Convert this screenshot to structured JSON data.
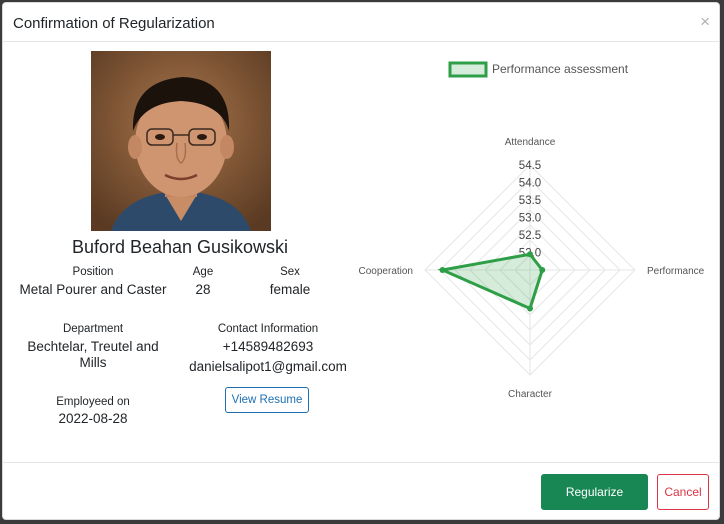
{
  "dialog": {
    "title": "Confirmation of Regularization",
    "close_label": "×"
  },
  "employee": {
    "name": "Buford Beahan Gusikowski",
    "position_label": "Position",
    "position": "Metal Pourer and Caster",
    "age_label": "Age",
    "age": "28",
    "sex_label": "Sex",
    "sex": "female",
    "department_label": "Department",
    "department": "Bechtelar, Treutel and Mills",
    "contact_label": "Contact Information",
    "phone": "+14589482693",
    "email": "danielsalipot1@gmail.com",
    "employed_label": "Employeed on",
    "employed_on": "2022-08-28",
    "resume_button": "View Resume"
  },
  "footer": {
    "regularize_button": "Regularize",
    "cancel_button": "Cancel"
  },
  "colors": {
    "primary": "#198754",
    "danger": "#dc3545",
    "link": "#1f6fb0"
  },
  "chart_data": {
    "type": "radar",
    "legend": [
      "Performance assessment"
    ],
    "axes": [
      "Attendance",
      "Performance",
      "Character",
      "Cooperation"
    ],
    "ticks": [
      "52.0",
      "52.5",
      "53.0",
      "53.5",
      "54.0",
      "54.5"
    ],
    "range": [
      51.5,
      54.5
    ],
    "series": [
      {
        "name": "Performance assessment",
        "values": [
          51.95,
          51.85,
          52.6,
          54.0
        ]
      }
    ],
    "color": "#2e9e47",
    "fill": "rgba(46,158,71,0.2)"
  }
}
